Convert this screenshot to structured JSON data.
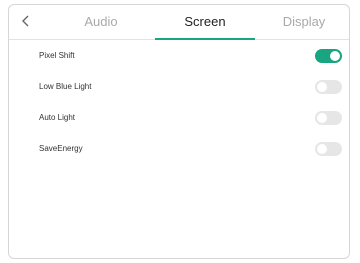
{
  "tabs": {
    "back_icon": "chevron-left-icon",
    "audio": "Audio",
    "screen": "Screen",
    "display": "Display",
    "active": "Screen"
  },
  "settings": [
    {
      "label": "Pixel Shift",
      "enabled": true
    },
    {
      "label": "Low Blue Light",
      "enabled": false
    },
    {
      "label": "Auto Light",
      "enabled": false
    },
    {
      "label": "SaveEnergy",
      "enabled": false
    }
  ],
  "colors": {
    "accent": "#18a57f",
    "toggle_off": "#e6e6e6",
    "tab_inactive": "#a9a9a9",
    "tab_active": "#222222"
  }
}
